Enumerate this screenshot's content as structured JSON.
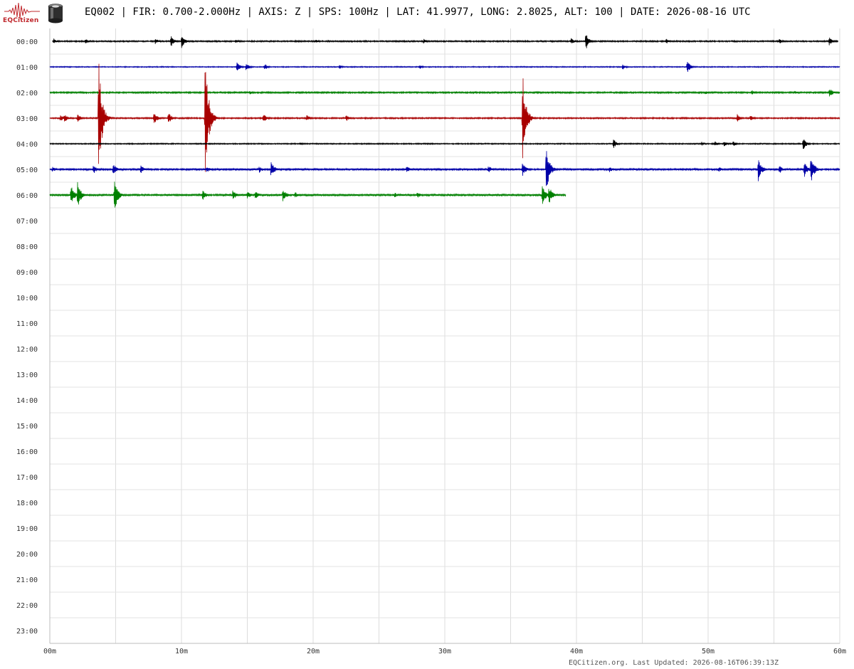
{
  "header": {
    "logo_text": "EQCitizen",
    "title": "EQ002 | FIR: 0.700-2.000Hz | AXIS: Z | SPS: 100Hz | LAT: 41.9977, LONG: 2.8025, ALT: 100 | DATE: 2026-08-16 UTC"
  },
  "icons": {
    "logo": "seismogram-wave-icon",
    "sensor": "seismometer-sensor-icon"
  },
  "footer": {
    "text": "EQCitizen.org. Last Updated: 2026-08-16T06:39:13Z"
  },
  "chart_data": {
    "type": "line",
    "title": "EQ002 | FIR: 0.700-2.000Hz | AXIS: Z | SPS: 100Hz | LAT: 41.9977, LONG: 2.8025, ALT: 100 | DATE: 2026-08-16 UTC",
    "xlabel": "",
    "ylabel": "",
    "xlim": [
      0,
      60
    ],
    "x_ticks": [
      "00m",
      "10m",
      "20m",
      "30m",
      "40m",
      "50m",
      "60m"
    ],
    "x_grid_step_minutes": 5,
    "hour_labels": [
      "00:00",
      "01:00",
      "02:00",
      "03:00",
      "04:00",
      "05:00",
      "06:00",
      "07:00",
      "08:00",
      "09:00",
      "10:00",
      "11:00",
      "12:00",
      "13:00",
      "14:00",
      "15:00",
      "16:00",
      "17:00",
      "18:00",
      "19:00",
      "20:00",
      "21:00",
      "22:00",
      "23:00"
    ],
    "grid": true,
    "colors": [
      "#000000",
      "#0000a8",
      "#008000",
      "#a80000"
    ],
    "series": [
      {
        "hour": 0,
        "color": "#000000",
        "start_minute": 0.2,
        "end_minute": 59.9,
        "noise": 0.8,
        "events": [
          [
            0.3,
            4
          ],
          [
            2.7,
            4
          ],
          [
            8.0,
            5
          ],
          [
            9.2,
            8
          ],
          [
            10.0,
            10
          ],
          [
            14.1,
            3
          ],
          [
            20.2,
            3
          ],
          [
            28.4,
            4
          ],
          [
            39.6,
            5
          ],
          [
            40.7,
            13
          ],
          [
            46.8,
            4
          ],
          [
            55.4,
            4
          ],
          [
            59.2,
            6
          ]
        ]
      },
      {
        "hour": 1,
        "color": "#0000a8",
        "start_minute": 0.0,
        "end_minute": 60.0,
        "noise": 0.6,
        "events": [
          [
            14.2,
            7
          ],
          [
            14.9,
            6
          ],
          [
            16.3,
            5
          ],
          [
            22.0,
            3
          ],
          [
            28.1,
            3
          ],
          [
            43.5,
            4
          ],
          [
            48.4,
            10
          ]
        ]
      },
      {
        "hour": 2,
        "color": "#008000",
        "start_minute": 0.0,
        "end_minute": 60.0,
        "noise": 0.9,
        "events": [
          [
            15.2,
            3
          ],
          [
            30.8,
            2
          ],
          [
            49.8,
            3
          ],
          [
            53.3,
            4
          ],
          [
            56.6,
            3
          ],
          [
            59.2,
            8
          ]
        ]
      },
      {
        "hour": 3,
        "color": "#a80000",
        "start_minute": 0.0,
        "end_minute": 60.0,
        "noise": 0.8,
        "events": [
          [
            0.8,
            5
          ],
          [
            1.1,
            7
          ],
          [
            2.1,
            6
          ],
          [
            3.7,
            90
          ],
          [
            7.9,
            10
          ],
          [
            9.0,
            9
          ],
          [
            11.8,
            95
          ],
          [
            12.2,
            12
          ],
          [
            16.2,
            7
          ],
          [
            19.5,
            5
          ],
          [
            22.5,
            5
          ],
          [
            35.9,
            68
          ],
          [
            52.2,
            7
          ],
          [
            53.2,
            5
          ]
        ]
      },
      {
        "hour": 4,
        "color": "#000000",
        "start_minute": 0.0,
        "end_minute": 60.0,
        "noise": 0.7,
        "events": [
          [
            19.0,
            2
          ],
          [
            42.8,
            7
          ],
          [
            49.5,
            3
          ],
          [
            50.5,
            4
          ],
          [
            51.2,
            4
          ],
          [
            51.9,
            4
          ],
          [
            57.2,
            10
          ]
        ]
      },
      {
        "hour": 5,
        "color": "#0000a8",
        "start_minute": 0.0,
        "end_minute": 60.0,
        "noise": 1.0,
        "events": [
          [
            0.2,
            4
          ],
          [
            3.3,
            7
          ],
          [
            4.8,
            10
          ],
          [
            6.9,
            7
          ],
          [
            11.9,
            5
          ],
          [
            15.9,
            5
          ],
          [
            16.8,
            13
          ],
          [
            27.1,
            5
          ],
          [
            33.3,
            6
          ],
          [
            35.9,
            10
          ],
          [
            37.7,
            35
          ],
          [
            42.5,
            5
          ],
          [
            50.8,
            4
          ],
          [
            53.8,
            18
          ],
          [
            55.4,
            7
          ],
          [
            57.3,
            12
          ],
          [
            57.8,
            22
          ]
        ]
      },
      {
        "hour": 6,
        "color": "#008000",
        "start_minute": 0.0,
        "end_minute": 39.2,
        "noise": 1.1,
        "events": [
          [
            1.6,
            15
          ],
          [
            2.1,
            20
          ],
          [
            4.9,
            25
          ],
          [
            11.6,
            8
          ],
          [
            13.9,
            8
          ],
          [
            15.0,
            6
          ],
          [
            15.6,
            7
          ],
          [
            17.7,
            10
          ],
          [
            18.6,
            5
          ],
          [
            26.2,
            4
          ],
          [
            27.9,
            5
          ],
          [
            37.4,
            16
          ],
          [
            37.9,
            14
          ]
        ]
      }
    ]
  }
}
